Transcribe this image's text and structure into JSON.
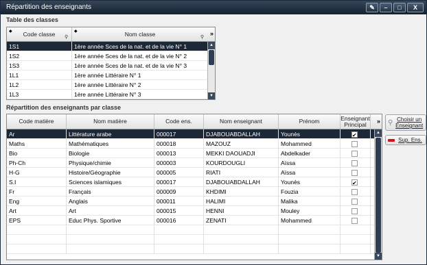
{
  "window": {
    "title": "Répartition des enseignants"
  },
  "table_classes": {
    "label": "Table des classes",
    "columns": [
      "Code classe",
      "Nom classe"
    ],
    "rows": [
      [
        "1S1",
        "1ère année Sces de la nat. et de la vie N° 1"
      ],
      [
        "1S2",
        "1ère année Sces de la nat. et de la vie N° 2"
      ],
      [
        "1S3",
        "1ère année Sces de la nat. et de la vie N° 3"
      ],
      [
        "1L1",
        "1ère année Littéraire N° 1"
      ],
      [
        "1L2",
        "1ère année Littéraire N° 2"
      ],
      [
        "1L3",
        "1ère année Littéraire N° 3"
      ]
    ],
    "selected_row": 0
  },
  "repartition": {
    "label": "Répartition des enseignants par classe",
    "columns": [
      "Code matière",
      "Nom matière",
      "Code ens.",
      "Nom enseignant",
      "Prénom",
      "Enseignant Principal"
    ],
    "rows": [
      {
        "code": "Ar",
        "matiere": "Littérature arabe",
        "code_ens": "000017",
        "nom": "DJABOUABDALLAH",
        "prenom": "Younès",
        "principal": true
      },
      {
        "code": "Maths",
        "matiere": "Mathématiques",
        "code_ens": "000018",
        "nom": "MAZOUZ",
        "prenom": "Mohammed",
        "principal": false
      },
      {
        "code": "Bio",
        "matiere": "Biologie",
        "code_ens": "000013",
        "nom": "MEKKI DAOUADJI",
        "prenom": "Abdelkader",
        "principal": false
      },
      {
        "code": "Ph-Ch",
        "matiere": "Physique/chimie",
        "code_ens": "000003",
        "nom": "KOURDOUGLI",
        "prenom": "Aïssa",
        "principal": false
      },
      {
        "code": "H-G",
        "matiere": "Histoire/Géographie",
        "code_ens": "000005",
        "nom": "RIATI",
        "prenom": "Aïssa",
        "principal": false
      },
      {
        "code": "S.I",
        "matiere": "Sciences islamiques",
        "code_ens": "000017",
        "nom": "DJABOUABDALLAH",
        "prenom": "Younès",
        "principal": true
      },
      {
        "code": "Fr",
        "matiere": "Français",
        "code_ens": "000009",
        "nom": "KHDIMI",
        "prenom": "Fouzia",
        "principal": false
      },
      {
        "code": "Eng",
        "matiere": "Anglais",
        "code_ens": "000011",
        "nom": "HALIMI",
        "prenom": "Malika",
        "principal": false
      },
      {
        "code": "Art",
        "matiere": "Art",
        "code_ens": "000015",
        "nom": "HENNI",
        "prenom": "Mouley",
        "principal": false
      },
      {
        "code": "EPS",
        "matiere": "Educ Phys. Sportive",
        "code_ens": "000016",
        "nom": "ZENATI",
        "prenom": "Mohammed",
        "principal": false
      }
    ],
    "selected_row": 0
  },
  "buttons": {
    "choisir": "Choisir un Enseignant",
    "supprimer": "Sup. Ens."
  },
  "titlebar_buttons": {
    "minimize": "–",
    "maximize": "□",
    "close": "X"
  },
  "colors": {
    "selection": "#1c2837",
    "titlebar": "#16212e"
  }
}
